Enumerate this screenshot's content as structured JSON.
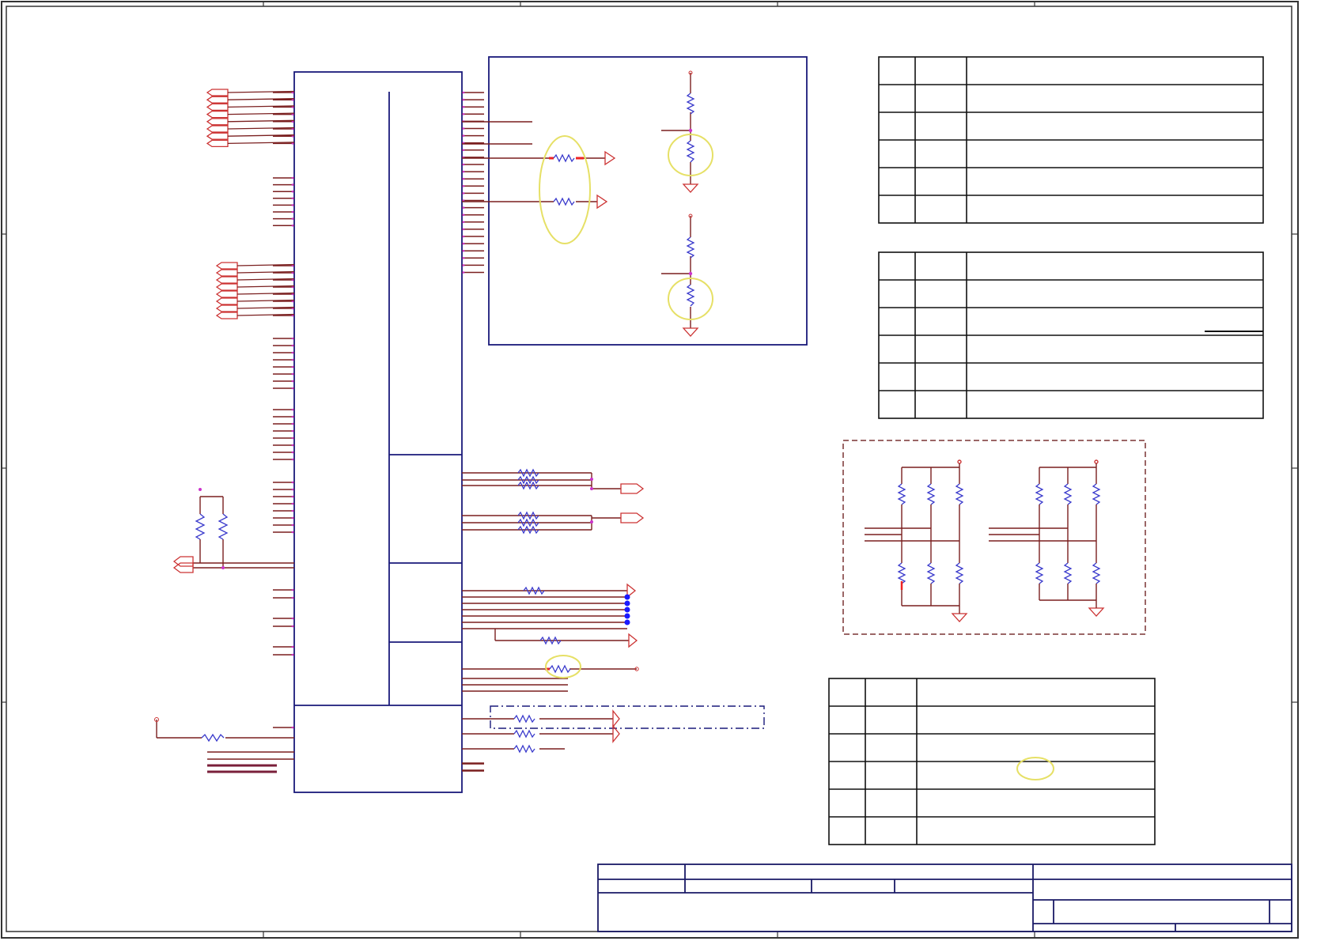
{
  "sheet": {
    "background": "#ffffff",
    "border_color": "#333333",
    "title_block_color": "#1a1a66"
  },
  "colors": {
    "wire": "#7a1f1f",
    "part_outline": "#1a1a7a",
    "resistor": "#3a3acc",
    "pin_dot": "#cc33cc",
    "highlight_circle": "#e6e066",
    "junction": "#1a1aff",
    "dashed_box": "#7a3333",
    "table_line": "#111111",
    "error_mark": "#ee2222"
  },
  "icons": {
    "ground": "ground-triangle-symbol",
    "resistor": "resistor-zigzag-symbol",
    "power": "power-arrow-symbol",
    "highlight": "yellow-ellipse-annotation"
  },
  "tables": {
    "revision_table_1_rows": 6,
    "revision_table_2_rows": 6,
    "revision_table_3_rows": 6
  }
}
